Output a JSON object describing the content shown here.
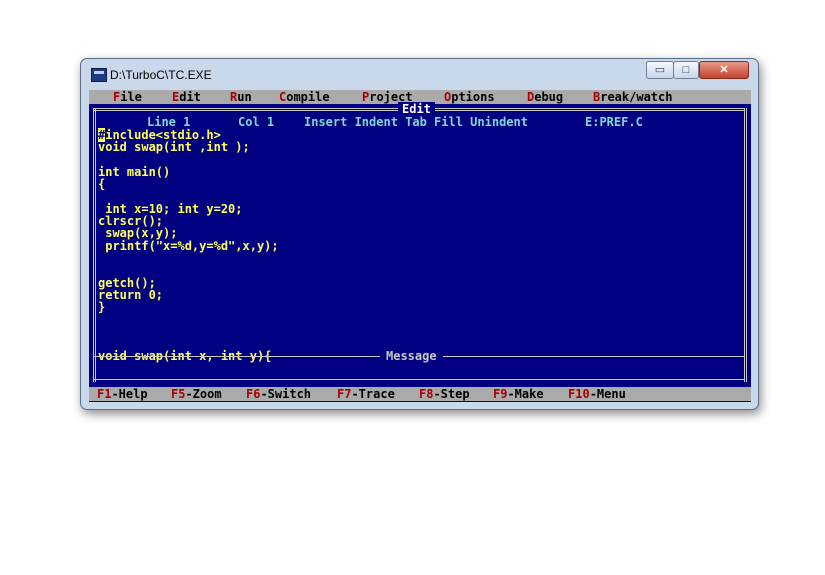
{
  "window": {
    "title": "D:\\TurboC\\TC.EXE",
    "minimize": "▭",
    "maximize": "□",
    "close": "✕"
  },
  "menu": [
    {
      "hot": "F",
      "rest": "ile"
    },
    {
      "hot": "E",
      "rest": "dit"
    },
    {
      "hot": "R",
      "rest": "un"
    },
    {
      "hot": "C",
      "rest": "ompile"
    },
    {
      "hot": "P",
      "rest": "roject"
    },
    {
      "hot": "O",
      "rest": "ptions"
    },
    {
      "hot": "D",
      "rest": "ebug"
    },
    {
      "hot": "B",
      "rest": "reak/watch"
    }
  ],
  "editor": {
    "title": "Edit",
    "status": {
      "line": "Line 1",
      "col": "Col 1",
      "modes": "Insert Indent Tab Fill Unindent",
      "file": "E:PREF.C"
    },
    "first_char": "#",
    "code": "include<stdio.h>\nvoid swap(int ,int );\n\nint main()\n{\n\n int x=10; int y=20;\nclrscr();\n swap(x,y);\n printf(\"x=%d,y=%d\",x,y);\n\n\ngetch();\nreturn 0;\n}\n\n\n\nvoid swap(int x, int y){"
  },
  "message": {
    "title": "Message"
  },
  "function_keys": [
    {
      "key": "F1",
      "label": "-Help"
    },
    {
      "key": "F5",
      "label": "-Zoom"
    },
    {
      "key": "F6",
      "label": "-Switch"
    },
    {
      "key": "F7",
      "label": "-Trace"
    },
    {
      "key": "F8",
      "label": "-Step"
    },
    {
      "key": "F9",
      "label": "-Make"
    },
    {
      "key": "F10",
      "label": "-Menu"
    }
  ],
  "colors": {
    "background": "#000080",
    "menu_bg": "#aaaaaa",
    "hotkey": "#a80000",
    "code_text": "#ffff55",
    "status_text": "#00aaaa"
  }
}
